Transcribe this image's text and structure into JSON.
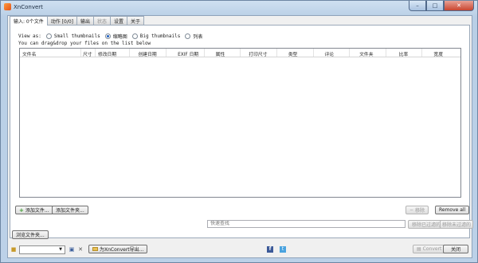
{
  "window": {
    "title": "XnConvert",
    "min": "–",
    "max": "□",
    "close": "✕"
  },
  "tabs": [
    {
      "label": "输入: 0个文件"
    },
    {
      "label": "动作 [0/0]"
    },
    {
      "label": "输出"
    },
    {
      "label": "状态"
    },
    {
      "label": "设置"
    },
    {
      "label": "关于"
    }
  ],
  "view": {
    "label": "View as",
    "options": [
      "Small thumbnails",
      "缩略图",
      "Big thumbnails",
      "列表"
    ],
    "selected": 1
  },
  "hint": "You can drag&drop your files on the list below",
  "columns": [
    "文件名",
    "尺寸",
    "修改日期",
    "创建日期",
    "EXIF 日期",
    "属性",
    "打印尺寸",
    "类型",
    "评论",
    "文件夹",
    "比率",
    "宽度"
  ],
  "buttons": {
    "add_files": "添加文件...",
    "add_folder": "添加文件夹...",
    "remove": "移除",
    "remove_all": "Remove all",
    "remove_filtered": "移除已过滤的",
    "remove_unfiltered": "移除未过滤的",
    "browse": "浏览文件夹...",
    "export": "为XnConvert导出...",
    "convert": "Convert",
    "close": "关闭"
  },
  "filter": {
    "placeholder": "快速查找"
  },
  "icons": {
    "app": "xnconvert-logo-icon",
    "folder": "folder-icon",
    "save": "save-icon",
    "delete": "delete-icon",
    "facebook": "facebook-icon",
    "twitter": "twitter-icon"
  }
}
